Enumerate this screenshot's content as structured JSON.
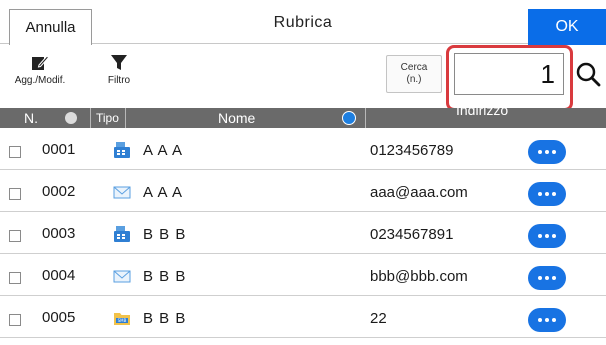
{
  "topbar": {
    "cancel_label": "Annulla",
    "title": "Rubrica",
    "ok_label": "OK"
  },
  "toolbar": {
    "edit_label": "Agg./Modif.",
    "filter_label": "Filtro",
    "search_label_line1": "Cerca",
    "search_label_line2": "(n.)",
    "search_value": "1"
  },
  "columns": {
    "number": "N.",
    "type": "Tipo",
    "name": "Nome",
    "address": "Indirizzo"
  },
  "rows": [
    {
      "number": "0001",
      "type_icon": "fax-icon",
      "name": "A A A",
      "address": "0123456789"
    },
    {
      "number": "0002",
      "type_icon": "email-icon",
      "name": "A A A",
      "address": "aaa@aaa.com"
    },
    {
      "number": "0003",
      "type_icon": "fax-icon",
      "name": "B B B",
      "address": "0234567891"
    },
    {
      "number": "0004",
      "type_icon": "email-icon",
      "name": "B B B",
      "address": "bbb@bbb.com"
    },
    {
      "number": "0005",
      "type_icon": "smb-folder-icon",
      "name": "B B B",
      "address": "22"
    }
  ],
  "colors": {
    "accent_blue": "#0a6de8",
    "highlight_red": "#d93a3e",
    "header_gray": "#6a6a6a"
  }
}
